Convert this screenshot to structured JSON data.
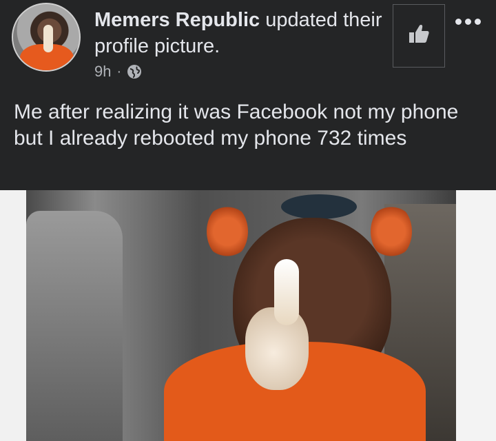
{
  "post": {
    "author_name": "Memers Republic",
    "action_text": "updated their profile picture.",
    "timestamp": "9h",
    "separator": "·",
    "privacy_icon": "globe-icon",
    "like_icon": "thumbs-up-icon",
    "more_icon": "more-options-icon",
    "caption": "Me after realizing it was Facebook not my phone but I already rebooted my phone 732 times"
  },
  "colors": {
    "background": "#242526",
    "primary_text": "#e4e6eb",
    "secondary_text": "#b0b3b8"
  }
}
